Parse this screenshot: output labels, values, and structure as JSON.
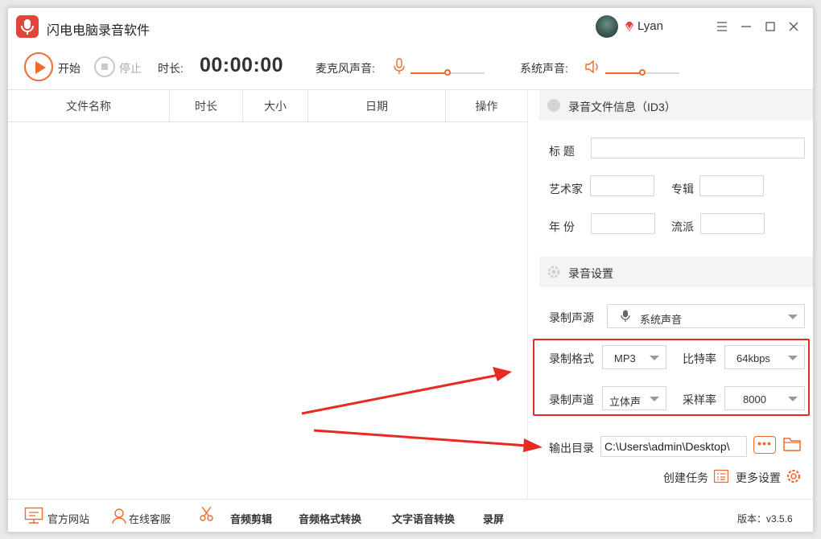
{
  "app": {
    "title": "闪电电脑录音软件"
  },
  "user": {
    "name": "Lyan"
  },
  "toolbar": {
    "start_label": "开始",
    "stop_label": "停止",
    "duration_label": "时长:",
    "duration_value": "00:00:00",
    "mic_label": "麦克风声音:",
    "mic_level": 0.5,
    "system_label": "系统声音:",
    "system_level": 0.5
  },
  "file_table": {
    "columns": [
      "文件名称",
      "时长",
      "大小",
      "日期",
      "操作"
    ]
  },
  "id3": {
    "section_title": "录音文件信息（ID3）",
    "title_label": "标    题",
    "artist_label": "艺术家",
    "album_label": "专辑",
    "year_label": "年    份",
    "genre_label": "流派"
  },
  "settings": {
    "section_title": "录音设置",
    "source_label": "录制声源",
    "source_value": "系统声音",
    "format_label": "录制格式",
    "format_value": "MP3",
    "bitrate_label": "比特率",
    "bitrate_value": "64kbps",
    "channel_label": "录制声道",
    "channel_value": "立体声",
    "samplerate_label": "采样率",
    "samplerate_value": "8000",
    "output_label": "输出目录",
    "output_value": "C:\\Users\\admin\\Desktop\\",
    "browse_label": "•••",
    "create_task_label": "创建任务",
    "more_settings_label": "更多设置"
  },
  "footer": {
    "website": "官方网站",
    "support": "在线客服",
    "audio_edit": "音频剪辑",
    "audio_convert": "音频格式转换",
    "tts": "文字语音转换",
    "screen_record": "录屏",
    "version": "版本：v3.5.6"
  },
  "colors": {
    "accent": "#ef6a2c",
    "annotation_red": "#e82a22",
    "logo_red": "#e2443a"
  }
}
